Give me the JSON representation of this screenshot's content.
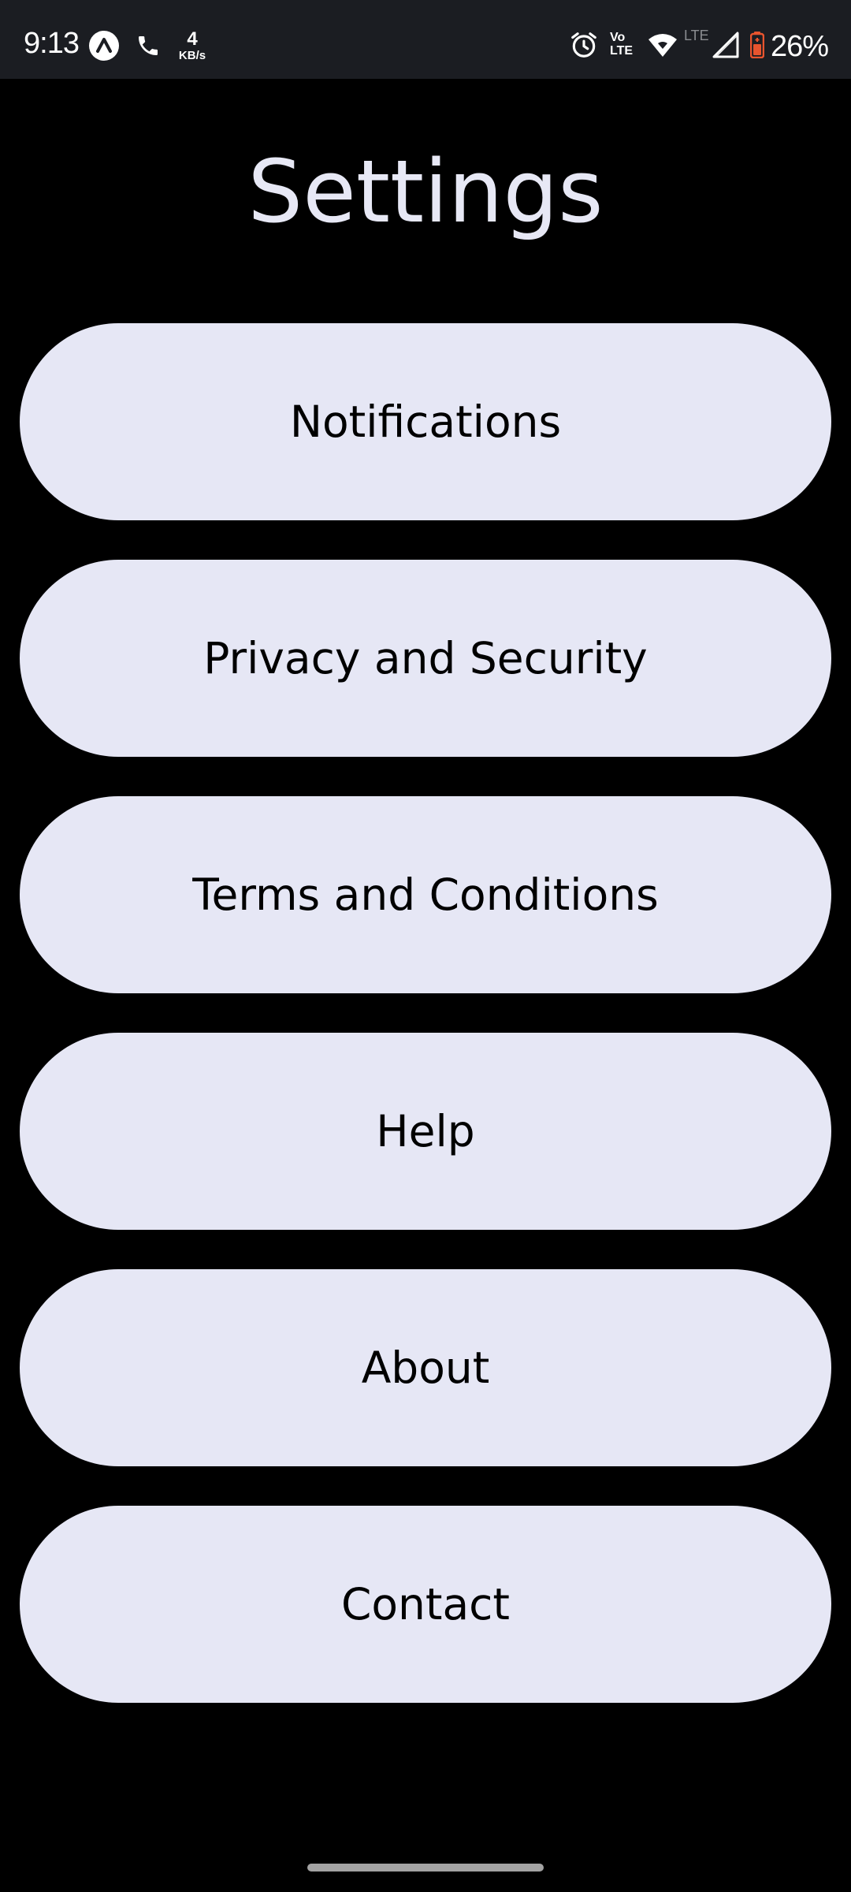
{
  "status_bar": {
    "time": "9:13",
    "net_speed_value": "4",
    "net_speed_unit": "KB/s",
    "volte_top": "Vo",
    "volte_bottom": "LTE",
    "lte_label": "LTE",
    "battery_percent": "26%",
    "battery_color": "#e8542e",
    "icons": [
      "app-notification-icon",
      "phone-call-icon",
      "alarm-icon",
      "wifi-icon",
      "signal-icon",
      "battery-icon"
    ]
  },
  "header": {
    "title": "Settings"
  },
  "menu": {
    "items": [
      {
        "label": "Notifications"
      },
      {
        "label": "Privacy and Security"
      },
      {
        "label": "Terms and Conditions"
      },
      {
        "label": "Help"
      },
      {
        "label": "About"
      },
      {
        "label": "Contact"
      }
    ]
  },
  "colors": {
    "background": "#000000",
    "status_bar": "#1b1d22",
    "button": "#e6e7f5",
    "title": "#e7e8f5"
  }
}
